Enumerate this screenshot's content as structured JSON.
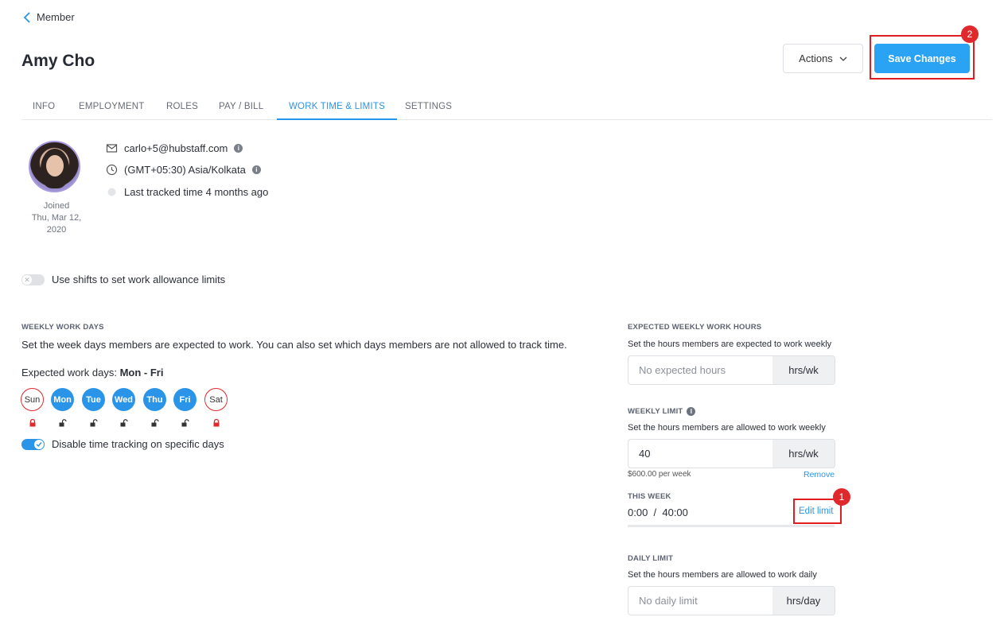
{
  "header": {
    "back_label": "Member",
    "title": "Amy Cho",
    "actions_label": "Actions",
    "save_label": "Save Changes",
    "badge_save": "2"
  },
  "tabs": [
    {
      "label": "INFO"
    },
    {
      "label": "EMPLOYMENT"
    },
    {
      "label": "ROLES"
    },
    {
      "label": "PAY / BILL"
    },
    {
      "label": "WORK TIME & LIMITS",
      "active": true
    },
    {
      "label": "SETTINGS"
    }
  ],
  "profile": {
    "email": "carlo+5@hubstaff.com",
    "timezone": "(GMT+05:30) Asia/Kolkata",
    "last_tracked": "Last tracked time 4 months ago",
    "joined_label": "Joined",
    "joined_date": "Thu, Mar 12, 2020"
  },
  "shifts": {
    "label": "Use shifts to set work allowance limits",
    "enabled": false
  },
  "weekly_work_days": {
    "heading": "WEEKLY WORK DAYS",
    "description": "Set the week days members are expected to work. You can also set which days members are not allowed to track time.",
    "expected_prefix": "Expected work days: ",
    "expected_value": "Mon - Fri",
    "days": [
      {
        "label": "Sun",
        "active": false,
        "locked": true
      },
      {
        "label": "Mon",
        "active": true,
        "locked": false
      },
      {
        "label": "Tue",
        "active": true,
        "locked": false
      },
      {
        "label": "Wed",
        "active": true,
        "locked": false
      },
      {
        "label": "Thu",
        "active": true,
        "locked": false
      },
      {
        "label": "Fri",
        "active": true,
        "locked": false
      },
      {
        "label": "Sat",
        "active": false,
        "locked": true
      }
    ],
    "disable_tracking_label": "Disable time tracking on specific days",
    "disable_tracking_enabled": true
  },
  "expected_weekly": {
    "heading": "EXPECTED WEEKLY WORK HOURS",
    "description": "Set the hours members are expected to work weekly",
    "placeholder": "No expected hours",
    "unit": "hrs/wk"
  },
  "weekly_limit": {
    "heading": "WEEKLY LIMIT",
    "description": "Set the hours members are allowed to work weekly",
    "value": "40",
    "unit": "hrs/wk",
    "per_week": "$600.00 per week",
    "remove_label": "Remove",
    "this_week_label": "THIS WEEK",
    "this_week_value": "0:00  /  40:00",
    "edit_limit_label": "Edit limit",
    "badge_edit": "1",
    "progress_fraction": 0
  },
  "daily_limit": {
    "heading": "DAILY LIMIT",
    "description": "Set the hours members are allowed to work daily",
    "placeholder": "No daily limit",
    "unit": "hrs/day"
  },
  "colors": {
    "accent": "#2a94e8",
    "save_button": "#2aa3f4",
    "highlight": "#e01e22"
  }
}
